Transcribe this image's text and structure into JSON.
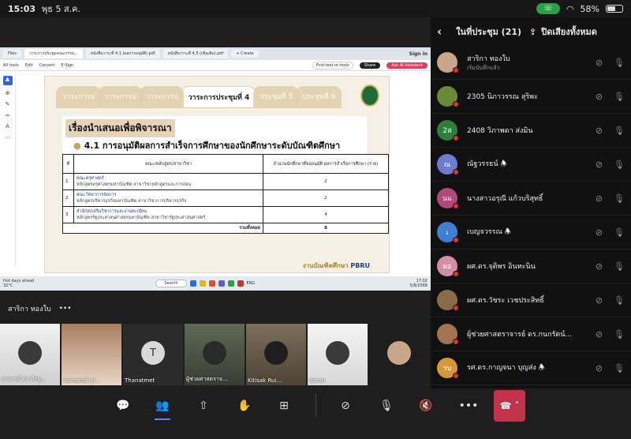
{
  "status": {
    "time": "15:03",
    "date": "พุธ 5 ส.ค.",
    "battery": "58%",
    "battery_level": 0.58
  },
  "browser": {
    "tabs": [
      "Files",
      "วาระการประชุมคณะกรรม...",
      "หนังสือวาระที่ 4.1 (ผลการอนุมัติ).pdf",
      "หนังสือวาระที่ 4.5 (เพิ่มเติม).pdf",
      "+ Create"
    ],
    "signin": "Sign in",
    "toolbar": [
      "All tools",
      "Edit",
      "Convert",
      "E-Sign"
    ],
    "find": "Find text or tools",
    "share": "Share",
    "ai": "Ask AI Assistant"
  },
  "slide": {
    "tabs": [
      "วาระการป",
      "วาระการป",
      "วาระการป",
      "วาระการประชุมที่ 4",
      "ประชุมที่ 5",
      "ประชุมที่ 6"
    ],
    "title": "เรื่องนำเสนอเพื่อพิจารณา",
    "subtitle": "4.1 การอนุมัติผลการสำเร็จการศึกษาของนักศึกษาระดับบัณฑิตศึกษา",
    "table": {
      "headers": [
        "ที่",
        "คณะ/หลักสูตร/สาขาวิชา",
        "จำนวนนักศึกษาที่ขออนุมัติ ผลการสำเร็จการศึกษา (ราย)"
      ],
      "rows": [
        {
          "no": "1",
          "faculty": "คณะครุศาสตร์",
          "program": "หลักสูตรครุศาสตรมหาบัณฑิต สาขาวิชาหลักสูตรและการสอน",
          "count": "2"
        },
        {
          "no": "2",
          "faculty": "คณะวิทยาการจัดการ",
          "program": "หลักสูตรบริหารธุรกิจมหาบัณฑิต สาขาวิชาการบริหารธุรกิจ",
          "count": "2"
        },
        {
          "no": "3",
          "faculty": "สำนักส่งเสริมวิชาการและงานทะเบียน",
          "program": "หลักสูตรรัฐประศาสนศาสตรมหาบัณฑิต สาขาวิชารัฐประศาสนศาสตร์",
          "count": "4"
        }
      ],
      "total_label": "รวมทั้งหมด",
      "total": "8"
    },
    "footer": "งานบัณฑิตศึกษา",
    "footer_brand": "PBRU"
  },
  "taskbar": {
    "weather": "Hot days ahead",
    "temp": "32°C",
    "search": "Search",
    "lang": "ENG",
    "clock": "17:02",
    "clock_date": "5/8/2568"
  },
  "presenter": {
    "name": "สาริกา ทองใบ",
    "more": "•••"
  },
  "thumbs": [
    {
      "name": "อาจารย์ ดร.พีรพู...",
      "kind": "photo"
    },
    {
      "name": "worawuit yi...",
      "kind": "photo"
    },
    {
      "name": "Thanatmet",
      "kind": "initial",
      "initial": "T"
    },
    {
      "name": "ผู้ช่วยศาสตราจ...",
      "kind": "photo"
    },
    {
      "name": "Kitisak Rui...",
      "kind": "photo"
    },
    {
      "name": "daran",
      "kind": "photo"
    },
    {
      "name": "",
      "kind": "avatar"
    }
  ],
  "panel": {
    "title": "ในที่ประชุม (21)",
    "mute_all": "ปิดเสียงทั้งหมด",
    "participants": [
      {
        "name": "สาริกา ทองใบ",
        "sub": "เริ่มบันทึกแล้ว",
        "avatar_color": "#c9a58a",
        "initials": ""
      },
      {
        "name": "2305 นิภาวรรณ สุริพะ",
        "sub": "",
        "avatar_color": "#6a8a3a",
        "initials": ""
      },
      {
        "name": "2408 วิภาพดา ส่งมิน",
        "sub": "",
        "avatar_color": "#2f7d3c",
        "initials": "2ส"
      },
      {
        "name": "ณัฐวรรธน์ 🕭",
        "sub": "",
        "avatar_color": "#6f7bd0",
        "initials": "ณ"
      },
      {
        "name": "นางสาวอรุณี แก้วบริสุทธิ์",
        "sub": "",
        "avatar_color": "#b2497a",
        "initials": "นแ"
      },
      {
        "name": "เบญจวรรณ 🕭",
        "sub": "",
        "avatar_color": "#3c7fd4",
        "initials": "เ"
      },
      {
        "name": "ผศ.ดร.จุติพร อินทะนิน",
        "sub": "",
        "avatar_color": "#d38ea6",
        "initials": "ผอ"
      },
      {
        "name": "ผศ.ดร.วัชระ เวชประสิทธิ์",
        "sub": "",
        "avatar_color": "#8a6a4a",
        "initials": ""
      },
      {
        "name": "ผู้ช่วยศาสตราจารย์ ดร.กนกรัตน์...",
        "sub": "",
        "avatar_color": "#a3744f",
        "initials": ""
      },
      {
        "name": "รศ.ดร.กาญจนา บุญส่ง 🕭",
        "sub": "",
        "avatar_color": "#d69836",
        "initials": "รบ"
      }
    ]
  },
  "controls": [
    "chat-icon",
    "people-icon",
    "share-screen-icon",
    "react-icon",
    "apps-icon",
    "camera-off-icon",
    "mic-off-icon",
    "speaker-off-icon",
    "more-icon",
    "leave-icon"
  ]
}
